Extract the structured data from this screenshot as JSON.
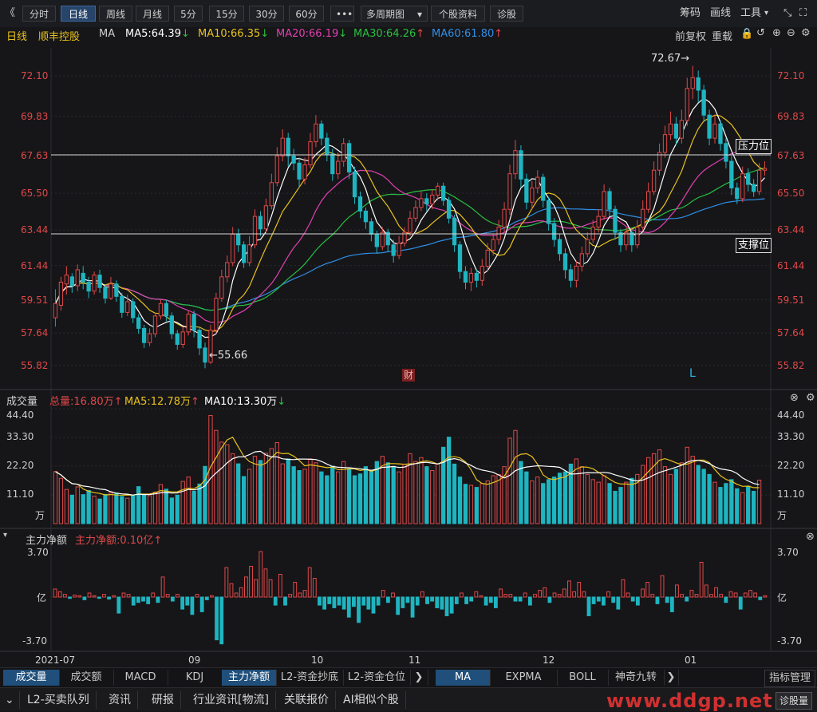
{
  "toolbar": {
    "back": "《",
    "tabs": [
      "分时",
      "日线",
      "周线",
      "月线",
      "5分",
      "15分",
      "30分",
      "60分"
    ],
    "active_tab": "日线",
    "more": "•••",
    "multi_period": "多周期图",
    "stock_info": "个股资料",
    "diagnose": "诊股",
    "right": {
      "chips": "筹码",
      "draw": "画线",
      "tools": "工具"
    }
  },
  "indicator_line": {
    "period": "日线",
    "stock": "顺丰控股",
    "ma": "MA",
    "ma5": "MA5:64.39",
    "ma10": "MA10:66.35",
    "ma20": "MA20:66.19",
    "ma30": "MA30:64.26",
    "ma60": "MA60:61.80",
    "arrows": {
      "down": "↓",
      "up": "↑"
    },
    "right": {
      "adjust": "前复权",
      "overlay": "重载"
    }
  },
  "colors": {
    "ma5": "#ffffff",
    "ma10": "#e8c21c",
    "ma20": "#e040b0",
    "ma30": "#28c040",
    "ma60": "#2f8fe8",
    "up": "#e04848",
    "down": "#1fb5c0",
    "axis_text": "#e04848",
    "vol_ma5": "#e8c21c",
    "vol_ma10": "#ffffff"
  },
  "price_axis": [
    "72.10",
    "69.83",
    "67.63",
    "65.50",
    "63.44",
    "61.44",
    "59.51",
    "57.64",
    "55.82"
  ],
  "annotations": {
    "high": "72.67",
    "high_arrow": "→",
    "low": "55.66",
    "low_arrow": "←",
    "resistance": "压力位",
    "support": "支撑位",
    "finance_tag": "财",
    "l_tag": "L"
  },
  "volume_panel": {
    "title": "成交量",
    "total": "总量:16.80万",
    "ma5": "MA5:12.78万",
    "ma10": "MA10:13.30万",
    "axis": [
      "44.40",
      "33.30",
      "22.20",
      "11.10"
    ],
    "unit": "万"
  },
  "flow_panel": {
    "title": "主力净额",
    "value": "主力净额:0.10亿",
    "axis_top": "3.70",
    "axis_mid": "亿",
    "axis_bottom": "-3.70"
  },
  "x_axis": [
    "2021-07",
    "09",
    "10",
    "11",
    "12",
    "01"
  ],
  "bottom_tabs": [
    "成交量",
    "成交额",
    "MACD",
    "KDJ",
    "主力净额",
    "L2-资金抄底",
    "L2-资金仓位"
  ],
  "bottom_tabs_active": [
    "成交量",
    "主力净额"
  ],
  "indicator_tabs": [
    "MA",
    "EXPMA",
    "BOLL",
    "神奇九转"
  ],
  "indicator_tabs_active": "MA",
  "indicator_manage": "指标管理",
  "bottom_bar": [
    "L2-买卖队列",
    "资讯",
    "研报",
    "行业资讯[物流]",
    "关联报价",
    "AI相似个股"
  ],
  "diagnose_btn": "诊股量",
  "watermark": "www.ddgp.net",
  "chart_data": {
    "type": "candlestick",
    "ylim": [
      55.0,
      73.5
    ],
    "candles": [
      [
        58.5,
        59.3,
        58.0,
        60.1
      ],
      [
        59.2,
        60.5,
        58.9,
        60.8
      ],
      [
        60.4,
        60.9,
        59.8,
        61.4
      ],
      [
        60.8,
        60.3,
        59.9,
        61.0
      ],
      [
        60.3,
        61.2,
        60.0,
        61.5
      ],
      [
        61.0,
        60.5,
        60.1,
        61.4
      ],
      [
        60.5,
        60.0,
        59.6,
        60.8
      ],
      [
        60.0,
        60.9,
        59.8,
        61.1
      ],
      [
        60.9,
        60.2,
        59.9,
        61.2
      ],
      [
        60.2,
        59.6,
        59.3,
        60.4
      ],
      [
        59.6,
        60.4,
        59.5,
        60.8
      ],
      [
        60.4,
        59.7,
        59.4,
        60.6
      ],
      [
        59.7,
        58.8,
        58.5,
        59.9
      ],
      [
        58.8,
        59.4,
        58.6,
        59.8
      ],
      [
        59.4,
        58.5,
        58.2,
        59.6
      ],
      [
        58.5,
        57.9,
        57.6,
        58.7
      ],
      [
        57.9,
        57.1,
        56.8,
        58.1
      ],
      [
        57.1,
        57.6,
        56.9,
        57.9
      ],
      [
        57.6,
        58.6,
        57.4,
        58.8
      ],
      [
        58.6,
        59.3,
        58.4,
        59.5
      ],
      [
        59.3,
        58.6,
        58.3,
        59.5
      ],
      [
        58.6,
        57.6,
        57.3,
        58.8
      ],
      [
        57.6,
        57.0,
        56.7,
        57.8
      ],
      [
        57.0,
        57.7,
        56.8,
        58.0
      ],
      [
        57.7,
        58.7,
        57.5,
        58.9
      ],
      [
        58.7,
        57.8,
        57.4,
        58.9
      ],
      [
        57.8,
        56.8,
        56.4,
        58.0
      ],
      [
        56.8,
        56.0,
        55.66,
        57.1
      ],
      [
        56.0,
        57.8,
        55.9,
        58.1
      ],
      [
        57.8,
        59.6,
        57.6,
        59.9
      ],
      [
        59.6,
        60.8,
        59.4,
        61.2
      ],
      [
        60.8,
        61.6,
        60.5,
        62.0
      ],
      [
        61.6,
        63.2,
        61.4,
        63.6
      ],
      [
        63.2,
        62.6,
        62.2,
        63.5
      ],
      [
        62.6,
        61.6,
        61.3,
        62.8
      ],
      [
        61.6,
        62.6,
        61.4,
        63.1
      ],
      [
        62.6,
        64.2,
        62.4,
        64.6
      ],
      [
        64.2,
        63.5,
        63.1,
        64.5
      ],
      [
        63.5,
        64.8,
        63.3,
        65.2
      ],
      [
        64.8,
        66.1,
        64.6,
        66.6
      ],
      [
        66.1,
        67.6,
        65.9,
        68.1
      ],
      [
        67.6,
        68.6,
        67.3,
        69.1
      ],
      [
        68.6,
        67.6,
        67.0,
        68.9
      ],
      [
        67.6,
        67.2,
        66.8,
        68.0
      ],
      [
        67.2,
        66.3,
        65.8,
        67.5
      ],
      [
        66.3,
        67.1,
        66.0,
        67.5
      ],
      [
        67.1,
        68.4,
        66.9,
        68.9
      ],
      [
        68.4,
        69.4,
        68.1,
        69.9
      ],
      [
        69.4,
        68.6,
        68.2,
        69.6
      ],
      [
        68.6,
        67.7,
        67.3,
        68.9
      ],
      [
        67.7,
        66.6,
        66.2,
        68.0
      ],
      [
        66.6,
        67.3,
        66.3,
        67.8
      ],
      [
        67.3,
        68.3,
        67.0,
        68.6
      ],
      [
        68.3,
        66.7,
        66.3,
        68.5
      ],
      [
        66.7,
        65.3,
        64.9,
        67.0
      ],
      [
        65.3,
        64.5,
        64.1,
        65.6
      ],
      [
        64.5,
        63.9,
        63.5,
        64.7
      ],
      [
        63.9,
        63.2,
        62.8,
        64.1
      ],
      [
        63.2,
        62.5,
        62.1,
        63.4
      ],
      [
        62.5,
        63.3,
        62.3,
        63.6
      ],
      [
        63.3,
        62.6,
        62.2,
        63.5
      ],
      [
        62.6,
        62.0,
        61.6,
        62.9
      ],
      [
        62.0,
        62.7,
        61.8,
        63.1
      ],
      [
        62.7,
        63.3,
        62.5,
        63.6
      ],
      [
        63.3,
        64.1,
        63.1,
        64.5
      ],
      [
        64.1,
        64.7,
        63.9,
        65.1
      ],
      [
        64.7,
        65.2,
        64.5,
        65.6
      ],
      [
        65.2,
        64.9,
        64.5,
        65.5
      ],
      [
        64.9,
        65.4,
        64.6,
        65.7
      ],
      [
        65.4,
        65.9,
        65.1,
        66.1
      ],
      [
        65.9,
        65.1,
        64.8,
        66.1
      ],
      [
        65.1,
        64.1,
        63.8,
        65.3
      ],
      [
        64.1,
        62.6,
        62.2,
        64.3
      ],
      [
        62.6,
        61.1,
        60.7,
        62.8
      ],
      [
        61.1,
        60.5,
        60.1,
        61.4
      ],
      [
        60.5,
        61.0,
        60.0,
        61.3
      ],
      [
        61.0,
        60.6,
        60.2,
        61.2
      ],
      [
        60.6,
        61.4,
        60.3,
        61.8
      ],
      [
        61.4,
        62.3,
        61.1,
        62.7
      ],
      [
        62.3,
        62.9,
        62.0,
        63.2
      ],
      [
        62.9,
        63.6,
        62.6,
        64.0
      ],
      [
        63.6,
        64.6,
        63.3,
        65.0
      ],
      [
        64.6,
        66.6,
        64.3,
        67.1
      ],
      [
        66.6,
        67.9,
        66.3,
        68.5
      ],
      [
        67.9,
        66.3,
        65.8,
        68.2
      ],
      [
        66.3,
        65.0,
        64.6,
        66.6
      ],
      [
        65.0,
        65.8,
        64.6,
        66.2
      ],
      [
        65.8,
        66.4,
        65.5,
        66.8
      ],
      [
        66.4,
        65.1,
        64.7,
        66.6
      ],
      [
        65.1,
        63.8,
        63.4,
        65.3
      ],
      [
        63.8,
        62.9,
        62.5,
        64.1
      ],
      [
        62.9,
        62.1,
        61.7,
        63.2
      ],
      [
        62.1,
        61.2,
        60.7,
        62.4
      ],
      [
        61.2,
        60.6,
        60.2,
        61.5
      ],
      [
        60.6,
        61.4,
        60.2,
        61.7
      ],
      [
        61.4,
        62.1,
        61.1,
        62.5
      ],
      [
        62.1,
        62.9,
        61.9,
        63.3
      ],
      [
        62.9,
        63.6,
        62.7,
        64.0
      ],
      [
        63.6,
        64.2,
        63.3,
        64.6
      ],
      [
        64.2,
        65.6,
        64.0,
        66.0
      ],
      [
        65.6,
        64.6,
        64.2,
        65.8
      ],
      [
        64.6,
        63.3,
        62.9,
        64.8
      ],
      [
        63.3,
        62.6,
        62.2,
        63.5
      ],
      [
        62.6,
        63.3,
        62.3,
        63.6
      ],
      [
        63.3,
        62.6,
        62.2,
        63.5
      ],
      [
        62.6,
        63.6,
        62.4,
        64.0
      ],
      [
        63.6,
        64.6,
        63.4,
        65.1
      ],
      [
        64.6,
        65.6,
        64.4,
        66.1
      ],
      [
        65.6,
        66.8,
        65.4,
        67.3
      ],
      [
        66.8,
        67.8,
        66.5,
        68.3
      ],
      [
        67.8,
        68.8,
        67.5,
        69.3
      ],
      [
        68.8,
        69.4,
        68.5,
        70.1
      ],
      [
        69.4,
        68.6,
        68.2,
        69.8
      ],
      [
        68.6,
        69.6,
        68.3,
        70.2
      ],
      [
        69.6,
        71.4,
        69.3,
        72.0
      ],
      [
        71.4,
        72.0,
        70.8,
        72.67
      ],
      [
        72.0,
        71.3,
        70.6,
        72.4
      ],
      [
        71.3,
        69.9,
        69.5,
        71.6
      ],
      [
        69.9,
        68.6,
        68.2,
        70.2
      ],
      [
        68.6,
        69.4,
        68.3,
        69.9
      ],
      [
        69.4,
        68.3,
        67.9,
        69.6
      ],
      [
        68.3,
        67.3,
        66.9,
        68.6
      ],
      [
        67.3,
        65.8,
        65.4,
        67.6
      ],
      [
        65.8,
        65.2,
        64.9,
        66.1
      ],
      [
        65.2,
        66.6,
        65.0,
        67.0
      ],
      [
        66.6,
        66.0,
        65.6,
        66.9
      ],
      [
        66.0,
        65.6,
        65.3,
        66.3
      ],
      [
        65.6,
        66.8,
        65.4,
        67.2
      ],
      [
        66.8,
        66.9,
        66.5,
        67.3
      ]
    ],
    "volume_ylim": [
      0,
      44.4
    ],
    "volume": [
      20.1,
      17.5,
      13.2,
      11.0,
      14.2,
      11.2,
      12.8,
      10.6,
      9.5,
      11.3,
      12.0,
      11.8,
      10.5,
      9.8,
      11.0,
      14.3,
      11.4,
      10.8,
      12.2,
      15.1,
      13.3,
      9.9,
      11.0,
      16.3,
      18.0,
      12.5,
      15.3,
      22.1,
      41.8,
      36.0,
      31.5,
      30.5,
      27.0,
      23.1,
      18.2,
      21.0,
      26.0,
      24.4,
      27.2,
      29.0,
      31.3,
      23.1,
      25.0,
      22.0,
      20.5,
      21.0,
      25.0,
      23.5,
      20.0,
      18.5,
      22.2,
      20.0,
      24.0,
      21.0,
      18.5,
      19.2,
      22.0,
      20.5,
      24.0,
      26.0,
      23.5,
      22.0,
      20.0,
      23.0,
      27.0,
      24.0,
      25.5,
      22.0,
      20.5,
      23.0,
      29.5,
      33.4,
      23.0,
      18.0,
      15.2,
      14.8,
      14.0,
      15.5,
      16.5,
      18.5,
      19.0,
      22.0,
      33.0,
      36.0,
      24.0,
      20.0,
      16.5,
      18.0,
      15.5,
      17.0,
      18.0,
      19.5,
      20.0,
      23.0,
      25.0,
      22.0,
      19.0,
      17.0,
      16.0,
      18.5,
      15.5,
      12.5,
      14.0,
      16.0,
      17.5,
      19.0,
      22.5,
      25.5,
      27.0,
      28.5,
      22.0,
      19.0,
      21.0,
      23.5,
      29.5,
      26.0,
      22.5,
      21.0,
      19.0,
      16.0,
      14.0,
      15.5,
      17.0,
      13.5,
      12.0,
      14.5,
      12.5,
      16.8
    ],
    "flow_ylim": [
      -3.7,
      3.7
    ],
    "flow": [
      0.6,
      0.4,
      0.2,
      -0.1,
      0.15,
      0.1,
      -0.2,
      0.3,
      0.1,
      -0.1,
      0.2,
      -0.15,
      0.1,
      -1.2,
      0.3,
      0.2,
      -0.6,
      -0.4,
      -0.3,
      -0.5,
      0.3,
      -0.4,
      1.5,
      0.2,
      -0.3,
      0.2,
      -0.9,
      -0.6,
      -1.3,
      0.2,
      -1.1,
      -0.2,
      0.1,
      -3.2,
      -3.5,
      2.2,
      1.0,
      0.3,
      0.7,
      1.5,
      2.3,
      1.3,
      3.4,
      2.1,
      1.3,
      -0.6,
      1.7,
      -0.6,
      0.2,
      1.1,
      0.3,
      0.5,
      2.2,
      1.4,
      -0.6,
      -0.9,
      -0.5,
      -0.8,
      -0.6,
      -0.9,
      -1.5,
      -0.7,
      -1.9,
      -0.6,
      -0.9,
      -1.2,
      -0.6,
      0.5,
      -0.4,
      0.3,
      -1.3,
      -0.8,
      -0.4,
      -1.5,
      -0.6,
      0.4,
      -0.5,
      -0.3,
      -0.8,
      -0.9,
      -1.4,
      -1.2,
      -0.5,
      0.3,
      -0.5,
      -0.3,
      0.4,
      0.1,
      -0.6,
      -0.4,
      -0.8,
      0.6,
      0.2,
      0.2,
      -0.3,
      -0.3,
      0.3,
      -0.6,
      0.2,
      0.5,
      0.7,
      -0.4,
      0.3,
      0.2,
      0.6,
      1.2,
      0.4,
      1.1,
      0.4,
      -1.4,
      -0.5,
      -0.3,
      -0.6,
      0.4,
      -0.4,
      -0.9,
      1.3,
      0.3,
      -0.3,
      -0.6,
      0.6,
      1.1,
      0.2,
      -0.5,
      1.6,
      -0.4,
      -1.1,
      0.9,
      0.2,
      -0.3,
      0.5,
      0.2,
      2.6,
      0.9,
      0.2,
      0.7,
      0.2,
      -0.4,
      0.4,
      0.3,
      -0.9,
      0.3,
      0.5,
      0.3,
      -0.2,
      0.1
    ]
  }
}
